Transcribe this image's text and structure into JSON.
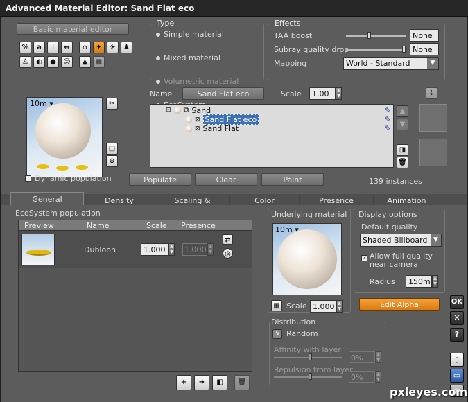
{
  "window": {
    "title": "Advanced Material Editor: Sand Flat eco"
  },
  "basic_button": "Basic material editor",
  "type": {
    "title": "Type",
    "options": [
      "Simple material",
      "Mixed material",
      "Volumetric material",
      "EcoSystem"
    ],
    "selected": "EcoSystem"
  },
  "effects": {
    "title": "Effects",
    "taa_label": "TAA boost",
    "taa_value": "None",
    "taa_level": 0.4,
    "subray_label": "Subray quality drop",
    "subray_value": "None",
    "subray_level": 1.0,
    "mapping_label": "Mapping",
    "mapping_value": "World - Standard"
  },
  "preview": {
    "zoom": "10m",
    "dynamic_label": "Dynamic population"
  },
  "name_row": {
    "name_label": "Name",
    "name_value": "Sand Flat eco",
    "scale_label": "Scale",
    "scale_value": "1.00"
  },
  "tree": {
    "root": "Sand",
    "children": [
      "Sand Flat eco",
      "Sand Flat"
    ],
    "selected": "Sand Flat eco"
  },
  "actions": {
    "populate": "Populate",
    "clear": "Clear",
    "paint": "Paint",
    "count": "139 instances"
  },
  "tabs": [
    "General",
    "Density",
    "Scaling & Orientation",
    "Color",
    "Presence",
    "Animation"
  ],
  "eco": {
    "title": "EcoSystem population",
    "headers": [
      "Preview",
      "Name",
      "Scale",
      "Presence"
    ],
    "rows": [
      {
        "name": "Dubloon",
        "scale": "1.000",
        "presence": "1.000"
      }
    ]
  },
  "underlying": {
    "title": "Underlying material",
    "zoom": "10m",
    "scale_label": "Scale",
    "scale_value": "1.000"
  },
  "display": {
    "title": "Display options",
    "default_quality_label": "Default quality",
    "quality_value": "Shaded Billboard",
    "allow_label": "Allow full quality near camera",
    "radius_label": "Radius",
    "radius_value": "150m"
  },
  "edit_alpha": "Edit Alpha",
  "distribution": {
    "title": "Distribution",
    "mode": "Random",
    "affinity_label": "Affinity with layer",
    "affinity_value": "0%",
    "repulsion_label": "Repulsion from layer",
    "repulsion_value": "0%"
  },
  "side_buttons": {
    "ok": "OK",
    "close": "✕",
    "help": "?"
  },
  "watermark": "pxleyes.com",
  "colors": {
    "accent": "#e8901c",
    "selection": "#3b6fb6"
  }
}
